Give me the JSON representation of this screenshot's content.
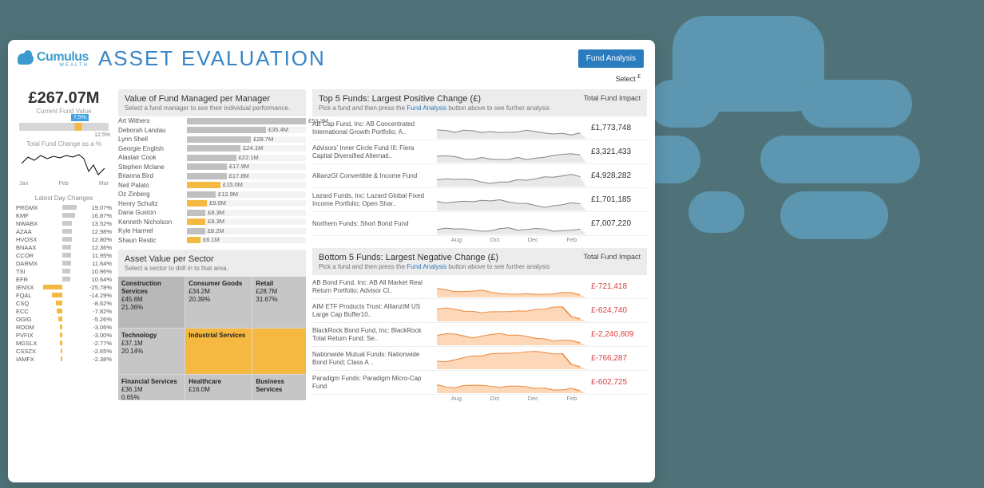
{
  "brand": {
    "name": "Cumulus",
    "sub": "WEALTH"
  },
  "page_title": "ASSET EVALUATION",
  "btn_fund_analysis": "Fund Analysis",
  "select_label": "Select",
  "currency_sup": "£",
  "current_fund_value": "£267.07M",
  "current_fund_value_lbl": "Current Fund Value",
  "change_pct_badge": "7.5%",
  "change_pct_right": "12.5%",
  "change_label": "Total Fund Change as a %",
  "months": [
    "Jan",
    "Feb",
    "Mar"
  ],
  "latest_day_title": "Latest Day Changes",
  "latest_day": [
    {
      "t": "PRGMX",
      "v": 19.07
    },
    {
      "t": "KMF",
      "v": 16.87
    },
    {
      "t": "NWABX",
      "v": 13.52
    },
    {
      "t": "AZAA",
      "v": 12.98
    },
    {
      "t": "HVOSX",
      "v": 12.8
    },
    {
      "t": "BNAAX",
      "v": 12.36
    },
    {
      "t": "CCOR",
      "v": 11.95
    },
    {
      "t": "DARMX",
      "v": 11.64
    },
    {
      "t": "TSI",
      "v": 10.96
    },
    {
      "t": "EFR",
      "v": 10.64
    },
    {
      "t": "IENSX",
      "v": -25.78
    },
    {
      "t": "FQAL",
      "v": -14.29
    },
    {
      "t": "CSQ",
      "v": -8.62
    },
    {
      "t": "ECC",
      "v": -7.82
    },
    {
      "t": "OGIG",
      "v": -5.26
    },
    {
      "t": "RODM",
      "v": -3.06
    },
    {
      "t": "PVFIX",
      "v": -3.0
    },
    {
      "t": "MGSLX",
      "v": -2.77
    },
    {
      "t": "CSSZX",
      "v": -2.65
    },
    {
      "t": "IAMFX",
      "v": -2.38
    }
  ],
  "managers_title": "Value of Fund Managed per Manager",
  "managers_sub": "Select a fund manager to see their individual performance.",
  "managers": [
    {
      "n": "Art Withers",
      "v": 53.3,
      "hl": false
    },
    {
      "n": "Deborah Landau",
      "v": 35.4,
      "hl": false
    },
    {
      "n": "Lynn Shell",
      "v": 28.7,
      "hl": false
    },
    {
      "n": "Georgie English",
      "v": 24.1,
      "hl": false
    },
    {
      "n": "Alastair Cook",
      "v": 22.1,
      "hl": false
    },
    {
      "n": "Stephen Mclane",
      "v": 17.9,
      "hl": false
    },
    {
      "n": "Brianna Bird",
      "v": 17.8,
      "hl": false
    },
    {
      "n": "Neil Palato",
      "v": 15.0,
      "hl": true
    },
    {
      "n": "Oz Zinberg",
      "v": 12.9,
      "hl": false
    },
    {
      "n": "Henry Schultz",
      "v": 9.0,
      "hl": true
    },
    {
      "n": "Dana Guston",
      "v": 8.3,
      "hl": false
    },
    {
      "n": "Kenneth Nicholson",
      "v": 8.3,
      "hl": true
    },
    {
      "n": "Kyle Harmel",
      "v": 8.2,
      "hl": false
    },
    {
      "n": "Shaun Restic",
      "v": 6.1,
      "hl": true
    }
  ],
  "sector_title": "Asset Value per Sector",
  "sector_sub": "Select a sector to drill in to that area.",
  "sectors": {
    "construction": {
      "n": "Construction Services",
      "v": "£45.6M",
      "p": "21.36%"
    },
    "consumer": {
      "n": "Consumer Goods",
      "v": "£34.2M",
      "p": "20.39%"
    },
    "retail": {
      "n": "Retail",
      "v": "£28.7M",
      "p": "31.67%"
    },
    "tech": {
      "n": "Technology",
      "v": "£37.1M",
      "p": "20.14%"
    },
    "industrial": {
      "n": "Industrial Services"
    },
    "financial": {
      "n": "Financial Services",
      "v": "£36.1M",
      "p": "0.65%"
    },
    "healthcare": {
      "n": "Healthcare",
      "v": "£16.0M"
    },
    "business": {
      "n": "Business Services"
    }
  },
  "top_title": "Top 5 Funds: Largest Positive Change (£)",
  "top_sub_a": "Pick a fund and then press the  ",
  "top_sub_link": "Fund Analysis",
  "top_sub_b": "  button above to see further analysis",
  "impact_hdr": "Total Fund Impact",
  "top_funds": [
    {
      "n": "AB Cap Fund, Inc: AB Concentrated International Growth Portfolio; A..",
      "v": "£1,773,748"
    },
    {
      "n": "Advisors' Inner Circle Fund III: Fiera Capital Diversified Alternati..",
      "v": "£3,321,433"
    },
    {
      "n": "AllianzGI Convertible & Income Fund",
      "v": "£4,928,282"
    },
    {
      "n": "Lazard Funds, Inc: Lazard Global Fixed Income Portfolio; Open Shar..",
      "v": "£1,701,185"
    },
    {
      "n": "Northern Funds: Short Bond Fund",
      "v": "£7,007,220"
    }
  ],
  "bot_title": "Bottom 5 Funds: Largest Negative Change (£)",
  "bot_sub_a": "Pick a fund and then press  the ",
  "bot_sub_b": " button  above to see further analysis",
  "bot_funds": [
    {
      "n": "AB Bond Fund, Inc: AB All Market Real Return Portfolio; Advisor Cl..",
      "v": "£-721,418"
    },
    {
      "n": "AIM ETF Products Trust: AllianzIM US Large Cap Buffer10..",
      "v": "£-624,740"
    },
    {
      "n": "BlackRock Bond Fund, Inc: BlackRock Total Return Fund; Se..",
      "v": "£-2,240,809"
    },
    {
      "n": "Nationwide Mutual Funds: Nationwide Bond Fund; Class A ..",
      "v": "£-766,287"
    },
    {
      "n": "Paradigm Funds: Paradigm Micro-Cap Fund",
      "v": "£-602,725"
    }
  ],
  "time_ticks": [
    "Aug",
    "Oct",
    "Dec",
    "Feb"
  ],
  "chart_data": {
    "type": "bar",
    "title": "Value of Fund Managed per Manager",
    "xlabel": "",
    "ylabel": "£M",
    "ylim": [
      0,
      55
    ],
    "categories": [
      "Art Withers",
      "Deborah Landau",
      "Lynn Shell",
      "Georgie English",
      "Alastair Cook",
      "Stephen Mclane",
      "Brianna Bird",
      "Neil Palato",
      "Oz Zinberg",
      "Henry Schultz",
      "Dana Guston",
      "Kenneth Nicholson",
      "Kyle Harmel",
      "Shaun Restic"
    ],
    "values": [
      53.3,
      35.4,
      28.7,
      24.1,
      22.1,
      17.9,
      17.8,
      15.0,
      12.9,
      9.0,
      8.3,
      8.3,
      8.2,
      6.1
    ]
  }
}
